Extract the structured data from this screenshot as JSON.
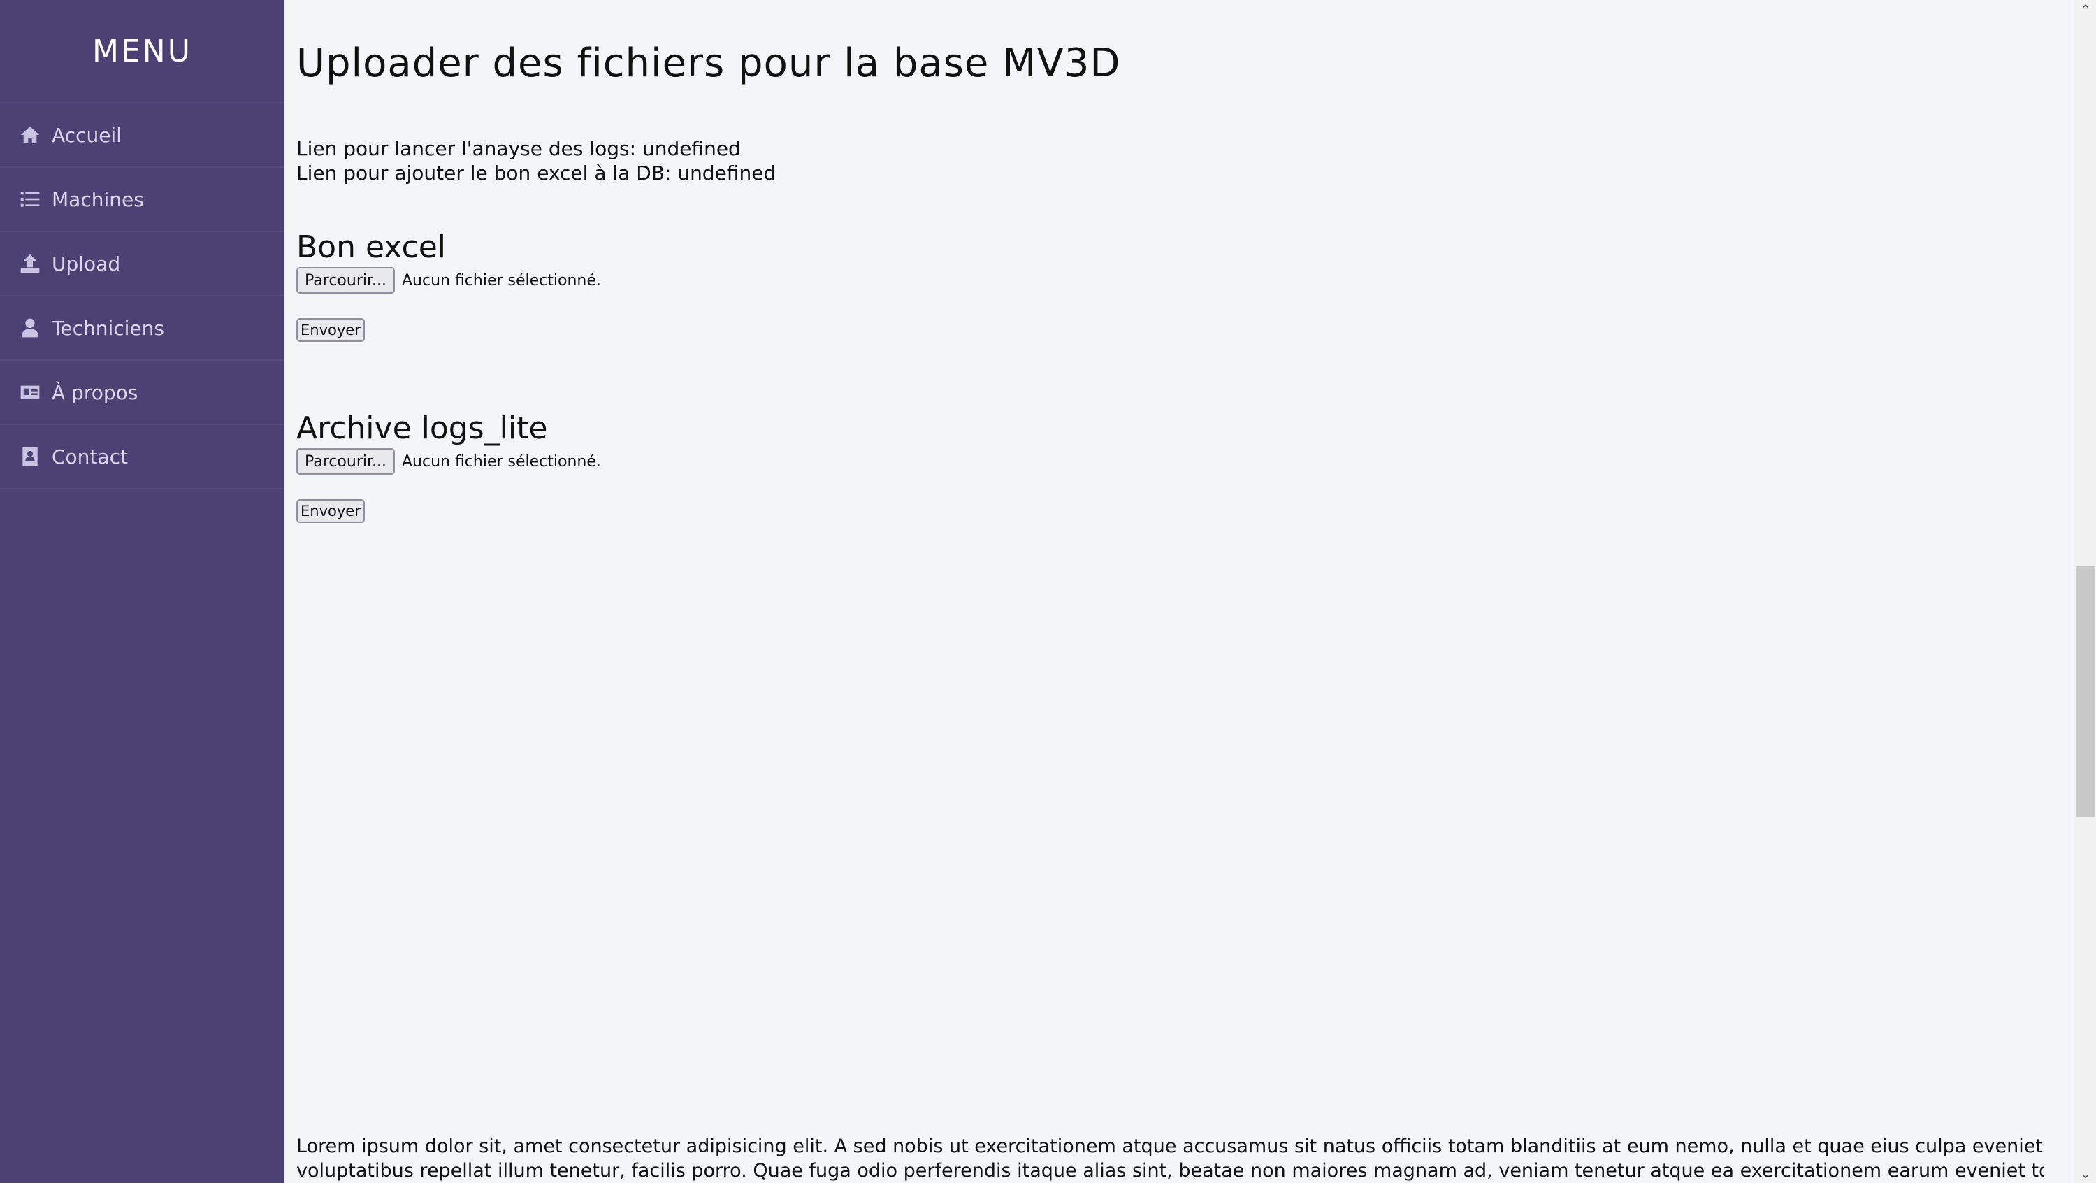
{
  "sidebar": {
    "title": "MENU",
    "items": [
      {
        "label": "Accueil",
        "icon": "home-icon"
      },
      {
        "label": "Machines",
        "icon": "list-icon"
      },
      {
        "label": "Upload",
        "icon": "upload-icon"
      },
      {
        "label": "Techniciens",
        "icon": "user-icon"
      },
      {
        "label": "À propos",
        "icon": "id-card-icon"
      },
      {
        "label": "Contact",
        "icon": "address-book-icon"
      }
    ]
  },
  "main": {
    "title": "Uploader des fichiers pour la base MV3D",
    "info_lines": [
      "Lien pour lancer l'anayse des logs: undefined",
      "Lien pour ajouter le bon excel à la DB: undefined"
    ],
    "sections": [
      {
        "title": "Bon excel",
        "browse_label": "Parcourir...",
        "file_status": "Aucun fichier sélectionné.",
        "submit_label": "Envoyer"
      },
      {
        "title": "Archive logs_lite",
        "browse_label": "Parcourir...",
        "file_status": "Aucun fichier sélectionné.",
        "submit_label": "Envoyer"
      }
    ],
    "footer_text": [
      "Lorem ipsum dolor sit, amet consectetur adipisicing elit. A sed nobis ut exercitationem atque accusamus sit natus officiis totam blanditiis at eum nemo, nulla et quae eius culpa eveniet",
      "voluptatibus repellat illum tenetur, facilis porro. Quae fuga odio perferendis itaque alias sint, beatae non maiores magnam ad, veniam tenetur atque ea exercitationem earum eveniet totam"
    ]
  },
  "colors": {
    "sidebar_bg": "#4b4273",
    "page_bg": "#f4f5f9",
    "sidebar_text": "#d9d5ec"
  }
}
